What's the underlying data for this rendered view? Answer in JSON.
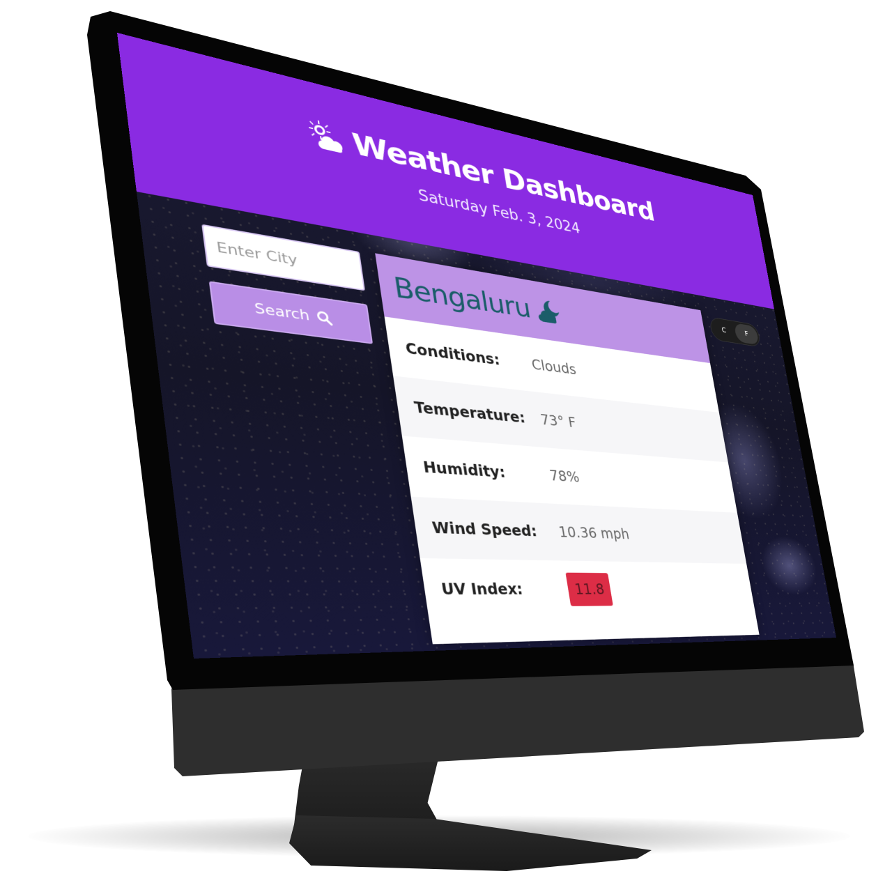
{
  "header": {
    "title": "Weather Dashboard",
    "date": "Saturday Feb. 3, 2024",
    "icon": "sun-cloud-icon"
  },
  "search": {
    "placeholder": "Enter City",
    "value": "",
    "button_label": "Search",
    "button_icon": "magnifier-icon"
  },
  "units": {
    "celsius_label": "C",
    "fahrenheit_label": "F",
    "selected": "F"
  },
  "weather": {
    "city": "Bengaluru",
    "city_icon": "cloud-moon-icon",
    "rows": [
      {
        "label": "Conditions:",
        "value": "Clouds"
      },
      {
        "label": "Temperature:",
        "value": "73° F"
      },
      {
        "label": "Humidity:",
        "value": "78%"
      },
      {
        "label": "Wind Speed:",
        "value": "10.36 mph"
      },
      {
        "label": "UV Index:",
        "value": "11.8"
      }
    ]
  },
  "colors": {
    "header_purple": "#8a2be2",
    "card_header_lavender": "#bd93e6",
    "search_button": "#b98ee6",
    "city_text_teal": "#1b5d69",
    "uv_badge_red": "#dc2d46"
  }
}
